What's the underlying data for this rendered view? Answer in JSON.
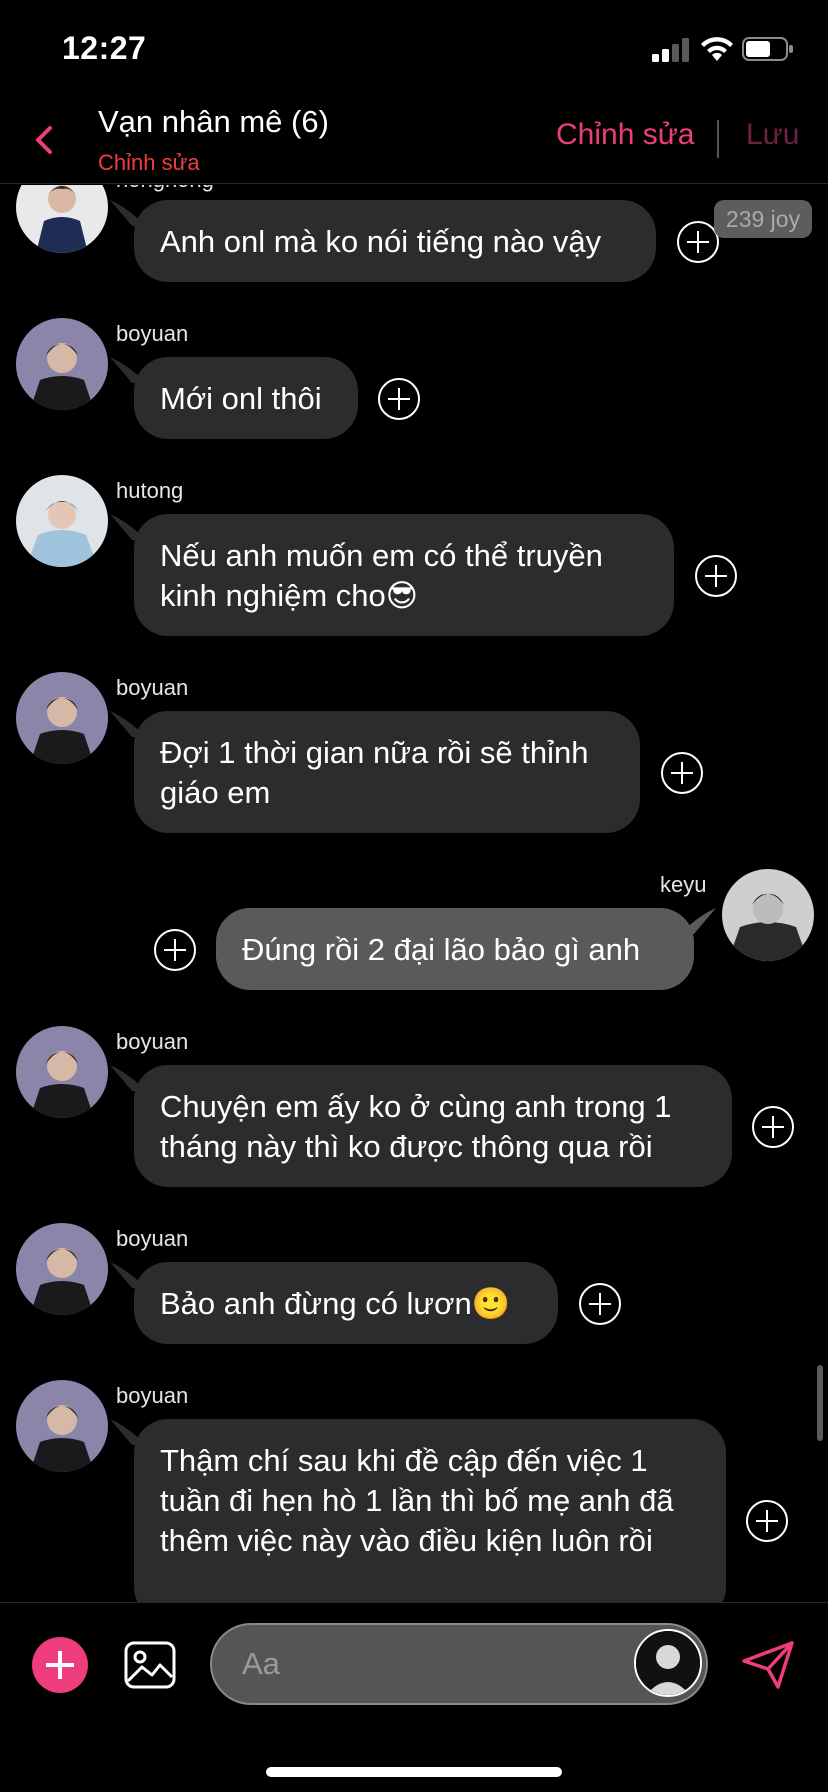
{
  "status_bar": {
    "time": "12:27"
  },
  "header": {
    "title": "Vạn nhân mê (6)",
    "subtitle": "Chỉnh sửa",
    "edit_label": "Chỉnh sửa",
    "save_label": "Lưu"
  },
  "chat": {
    "partial_sender": "hongnong",
    "joy_badge": "239 joy",
    "messages": [
      {
        "sender": "",
        "text": "Anh onl mà ko nói tiếng nào vậy",
        "self": false
      },
      {
        "sender": "boyuan",
        "text": "Mới onl thôi",
        "self": false
      },
      {
        "sender": "hutong",
        "text": "Nếu anh muốn em có thể truyền kinh nghiệm cho😎",
        "self": false
      },
      {
        "sender": "boyuan",
        "text": "Đợi 1 thời gian nữa rồi sẽ thỉnh giáo em",
        "self": false
      },
      {
        "sender": "keyu",
        "text": "Đúng rồi 2 đại lão bảo gì anh",
        "self": true
      },
      {
        "sender": "boyuan",
        "text": "Chuyện em ấy ko ở cùng anh trong 1 tháng này thì ko được thông qua rồi",
        "self": false
      },
      {
        "sender": "boyuan",
        "text": "Bảo anh đừng có lươn🙂",
        "self": false
      },
      {
        "sender": "boyuan",
        "text": "Thậm chí sau khi đề cập đến việc 1 tuần đi hẹn hò 1 lần thì bố mẹ anh đã thêm việc này vào điều kiện luôn rồi",
        "self": false
      }
    ]
  },
  "composer": {
    "placeholder": "Aa"
  },
  "colors": {
    "accent": "#ee3d7c",
    "subtitle": "#ef3e3e",
    "bubble": "#2c2c2e",
    "self_bubble": "#5a5a5c"
  },
  "icons": [
    "signal-icon",
    "wifi-icon",
    "battery-icon",
    "back-chevron-icon",
    "plus-circle-icon",
    "image-icon",
    "send-icon",
    "avatar-icon"
  ]
}
